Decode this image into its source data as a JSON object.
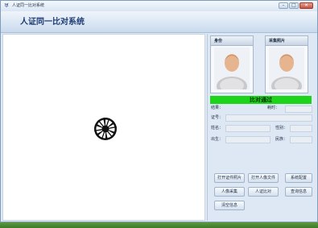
{
  "window": {
    "title": "人证同一比对系统",
    "buttons": {
      "minimize": "–",
      "maximize": "□",
      "close": "✕"
    }
  },
  "header": {
    "title": "人证同一比对系统"
  },
  "photos": {
    "id_label": "身份",
    "capture_label": "采集照片"
  },
  "result_banner": "比对通过",
  "fields": {
    "result_label": "结果：",
    "time_label": "耗时：",
    "id_label": "证号：",
    "name_label": "姓名：",
    "gender_label": "性别：",
    "birth_label": "出生：",
    "ethnicity_label": "民族："
  },
  "buttons": {
    "open_id_photo": "打开证件照片",
    "open_face_file": "打开人像文件",
    "system_config": "系统配置",
    "face_capture": "人像采集",
    "id_compare": "人证比对",
    "query_info": "查询信息",
    "clear_info": "清空信息"
  },
  "icons": {
    "app": "app-icon",
    "shutter": "camera-shutter-icon",
    "person": "person-silhouette-icon"
  },
  "colors": {
    "result_pass": "#1ed41a",
    "header_title": "#1d3b72"
  }
}
